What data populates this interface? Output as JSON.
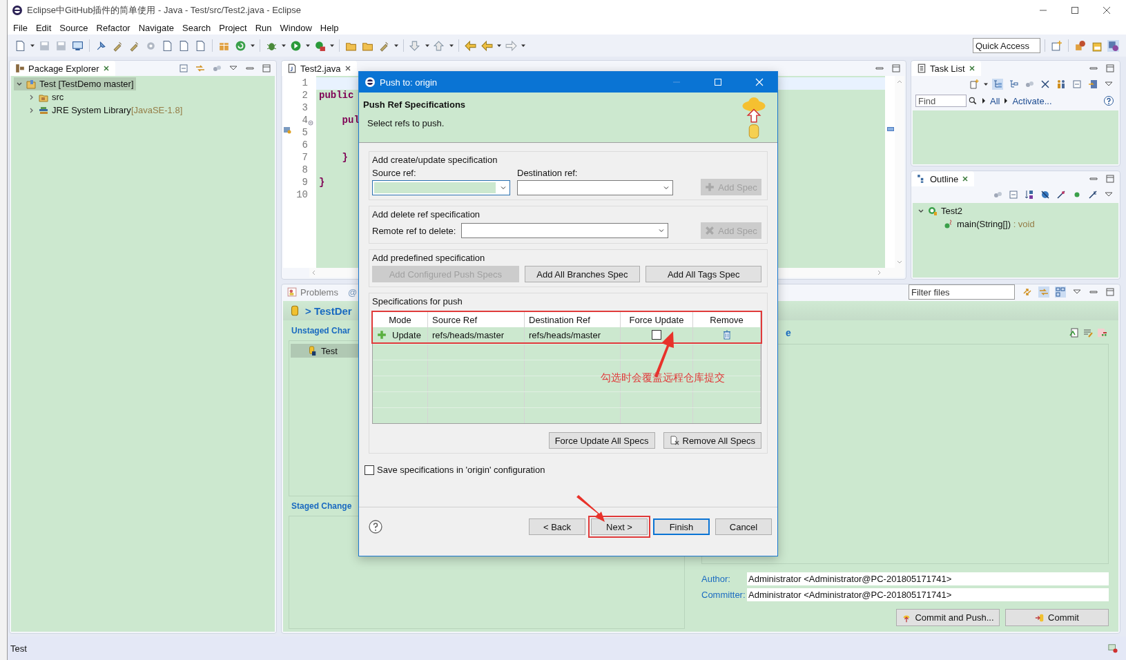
{
  "window": {
    "title": "Eclipse中GitHub插件的简单使用 - Java - Test/src/Test2.java - Eclipse"
  },
  "menu": [
    "File",
    "Edit",
    "Source",
    "Refactor",
    "Navigate",
    "Search",
    "Project",
    "Run",
    "Window",
    "Help"
  ],
  "quick_access": {
    "placeholder": "Quick Access"
  },
  "package_explorer": {
    "title": "Package Explorer",
    "tree": [
      {
        "label": "Test [TestDemo master]",
        "expanded": true,
        "selected": true,
        "children": [
          {
            "label": "src",
            "expanded": false,
            "selected": false
          },
          {
            "label": "JRE System Library",
            "decoration": "[JavaSE-1.8]",
            "expanded": false,
            "selected": false
          }
        ]
      }
    ]
  },
  "editor": {
    "tab": "Test2.java",
    "lines": [
      {
        "number": "1"
      },
      {
        "number": "2",
        "code": "public"
      },
      {
        "number": "3"
      },
      {
        "number": "4",
        "code": "    pul"
      },
      {
        "number": "5"
      },
      {
        "number": "6"
      },
      {
        "number": "7",
        "code": "    }"
      },
      {
        "number": "8"
      },
      {
        "number": "9",
        "code": "}"
      },
      {
        "number": "10"
      }
    ]
  },
  "task_list": {
    "title": "Task List",
    "find": {
      "placeholder": "Find"
    },
    "links": [
      "All",
      "Activate..."
    ]
  },
  "outline": {
    "title": "Outline",
    "tree": [
      {
        "label": "Test2",
        "expanded": true,
        "children": [
          {
            "label": "main(String[])",
            "type": " : void"
          }
        ]
      }
    ]
  },
  "staging": {
    "tabs": [
      "Problems",
      "@"
    ],
    "repo": "> TestDer",
    "filter": {
      "placeholder": "Filter files"
    },
    "unstaged": {
      "title": "Unstaged Char",
      "files": [
        {
          "name": "Test",
          "selected": true
        }
      ]
    },
    "staged": {
      "title": "Staged Change"
    },
    "message_title": "e",
    "author": {
      "label": "Author:",
      "value": "Administrator <Administrator@PC-201805171741>"
    },
    "committer": {
      "label": "Committer:",
      "value": "Administrator <Administrator@PC-201805171741>"
    },
    "buttons": [
      "Commit and Push...",
      "Commit"
    ]
  },
  "status_bar": "Test",
  "dialog": {
    "title": "Push to: origin",
    "heading": "Push Ref Specifications",
    "description": "Select refs to push.",
    "create_group": {
      "title": "Add create/update specification",
      "source_label": "Source ref:",
      "destination_label": "Destination ref:",
      "button": {
        "label": "Add Spec",
        "disabled": true
      }
    },
    "delete_group": {
      "title": "Add delete ref specification",
      "label": "Remote ref to delete:",
      "button": {
        "label": "Add Spec",
        "disabled": true
      }
    },
    "predefined_group": {
      "title": "Add predefined specification",
      "buttons": [
        {
          "label": "Add Configured Push Specs",
          "disabled": true
        },
        {
          "label": "Add All Branches Spec",
          "disabled": false
        },
        {
          "label": "Add All Tags Spec",
          "disabled": false
        }
      ]
    },
    "specs_group": {
      "title": "Specifications for push",
      "highlighted": true,
      "columns": [
        "Mode",
        "Source Ref",
        "Destination Ref",
        "Force Update",
        "Remove"
      ],
      "rows": [
        {
          "mode": "Update",
          "source": "refs/heads/master",
          "destination": "refs/heads/master",
          "force_update": false
        }
      ],
      "buttons": [
        "Force Update All Specs",
        "Remove All Specs"
      ]
    },
    "save_option": {
      "label": "Save specifications in 'origin' configuration",
      "checked": false
    },
    "buttons": [
      {
        "label": "< Back",
        "default": false,
        "highlighted": false
      },
      {
        "label": "Next >",
        "default": false,
        "highlighted": true
      },
      {
        "label": "Finish",
        "default": true,
        "highlighted": false
      },
      {
        "label": "Cancel",
        "default": false,
        "highlighted": false
      }
    ]
  },
  "annotation": {
    "note": "勾选时会覆盖远程仓库提交"
  }
}
